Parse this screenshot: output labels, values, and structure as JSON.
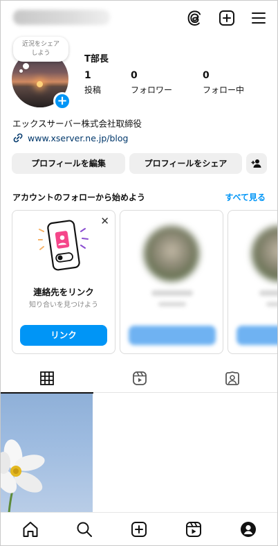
{
  "header": {
    "icons": [
      "threads-icon",
      "plus-square-icon",
      "hamburger-menu-icon"
    ]
  },
  "note_bubble": {
    "line1": "近況をシェア",
    "line2": "しよう"
  },
  "profile": {
    "name": "T部長",
    "stats": [
      {
        "value": "1",
        "label": "投稿"
      },
      {
        "value": "0",
        "label": "フォロワー"
      },
      {
        "value": "0",
        "label": "フォロー中"
      }
    ],
    "bio": "エックスサーバー株式会社取締役",
    "link": "www.xserver.ne.jp/blog"
  },
  "actions": {
    "edit_profile": "プロフィールを編集",
    "share_profile": "プロフィールをシェア"
  },
  "suggestions": {
    "title": "アカウントのフォローから始めよう",
    "see_all": "すべて見る",
    "contacts_card": {
      "title": "連絡先をリンク",
      "subtitle": "知り合いを見つけよう",
      "button": "リンク"
    }
  },
  "tabs": [
    "grid-icon",
    "reels-icon",
    "tagged-icon"
  ],
  "bottom_nav": [
    "home-icon",
    "search-icon",
    "create-icon",
    "reels-icon",
    "profile-icon"
  ],
  "colors": {
    "accent": "#0095f6",
    "link": "#00376b"
  }
}
